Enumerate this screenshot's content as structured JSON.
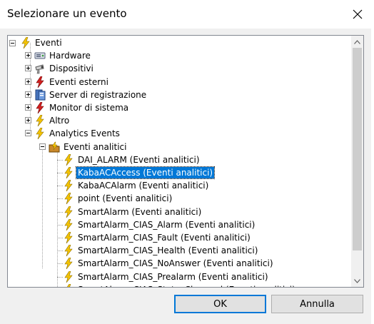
{
  "window": {
    "title": "Selezionare un evento"
  },
  "tree": {
    "root": "Eventi",
    "categories": [
      {
        "label": "Hardware",
        "icon": "hardware-icon"
      },
      {
        "label": "Dispositivi",
        "icon": "devices-icon"
      },
      {
        "label": "Eventi esterni",
        "icon": "external-event-icon"
      },
      {
        "label": "Server di registrazione",
        "icon": "server-icon"
      },
      {
        "label": "Monitor di sistema",
        "icon": "monitor-event-icon"
      },
      {
        "label": "Altro",
        "icon": "lightning-icon"
      },
      {
        "label": "Analytics Events",
        "icon": "lightning-icon"
      }
    ],
    "subgroup": "Eventi analitici",
    "events": [
      "DAI_ALARM (Eventi analitici)",
      "KabaACAccess (Eventi analitici)",
      "KabaACAlarm (Eventi analitici)",
      "point (Eventi analitici)",
      "SmartAlarm (Eventi analitici)",
      "SmartAlarm_CIAS_Alarm (Eventi analitici)",
      "SmartAlarm_CIAS_Fault (Eventi analitici)",
      "SmartAlarm_CIAS_Health (Eventi analitici)",
      "SmartAlarm_CIAS_NoAnswer (Eventi analitici)",
      "SmartAlarm_CIAS_Prealarm (Eventi analitici)",
      "SmartAlarm_CIAS_StatusChanged (Eventi analitici)"
    ],
    "selected_event": "KabaACAccess (Eventi analitici)"
  },
  "buttons": {
    "ok": "OK",
    "cancel": "Annulla"
  },
  "colors": {
    "selection": "#0078d7",
    "event_icon": "#f5c400",
    "external_event_icon": "#d42020"
  }
}
